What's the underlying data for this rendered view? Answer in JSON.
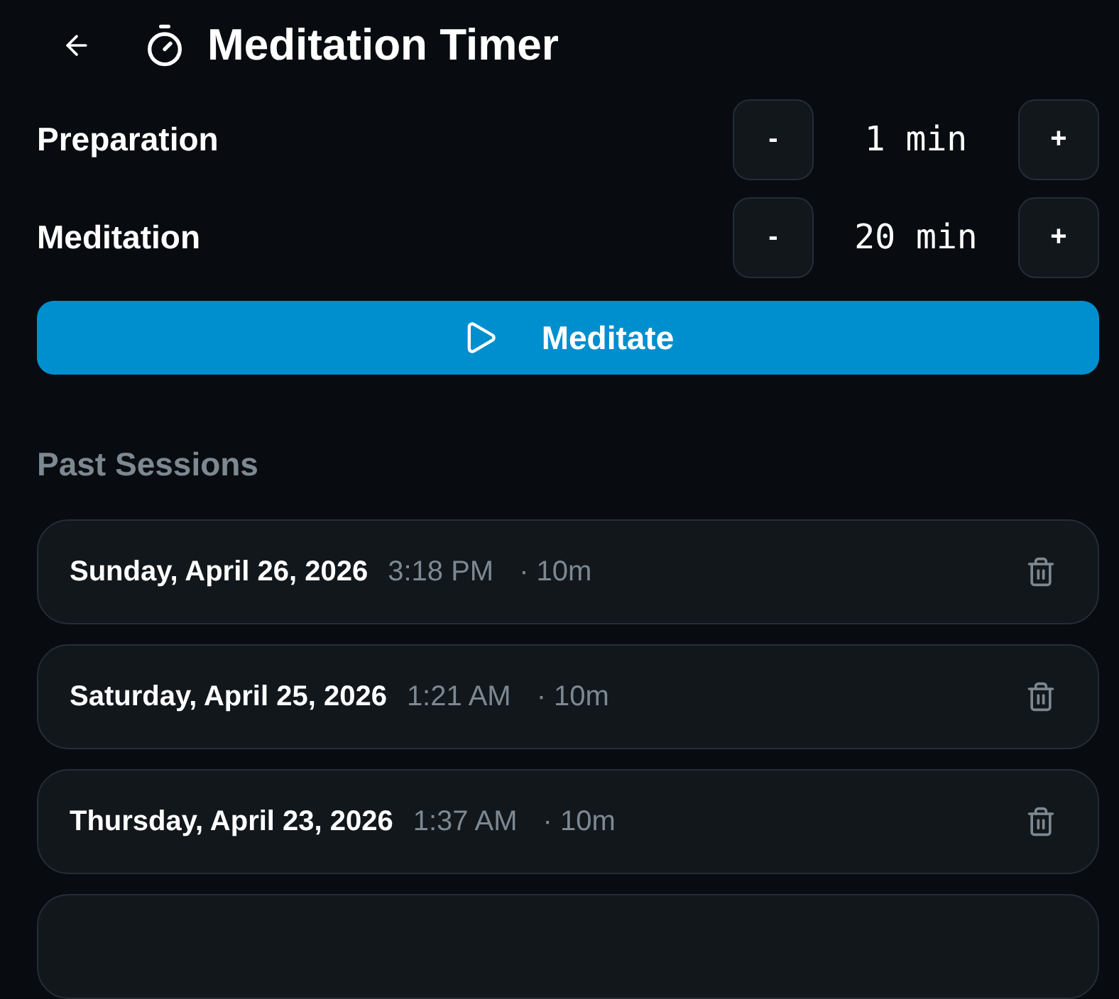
{
  "header": {
    "title": "Meditation Timer"
  },
  "settings": [
    {
      "label": "Preparation",
      "decrement": "-",
      "value": "1 min",
      "increment": "+"
    },
    {
      "label": "Meditation",
      "decrement": "-",
      "value": "20 min",
      "increment": "+"
    }
  ],
  "start_button": {
    "label": "Meditate"
  },
  "past_sessions": {
    "heading": "Past Sessions",
    "items": [
      {
        "date": "Sunday, April 26, 2026",
        "time": "3:18 PM",
        "duration": "· 10m"
      },
      {
        "date": "Saturday, April 25, 2026",
        "time": "1:21 AM",
        "duration": "· 10m"
      },
      {
        "date": "Thursday, April 23, 2026",
        "time": "1:37 AM",
        "duration": "· 10m"
      }
    ]
  }
}
